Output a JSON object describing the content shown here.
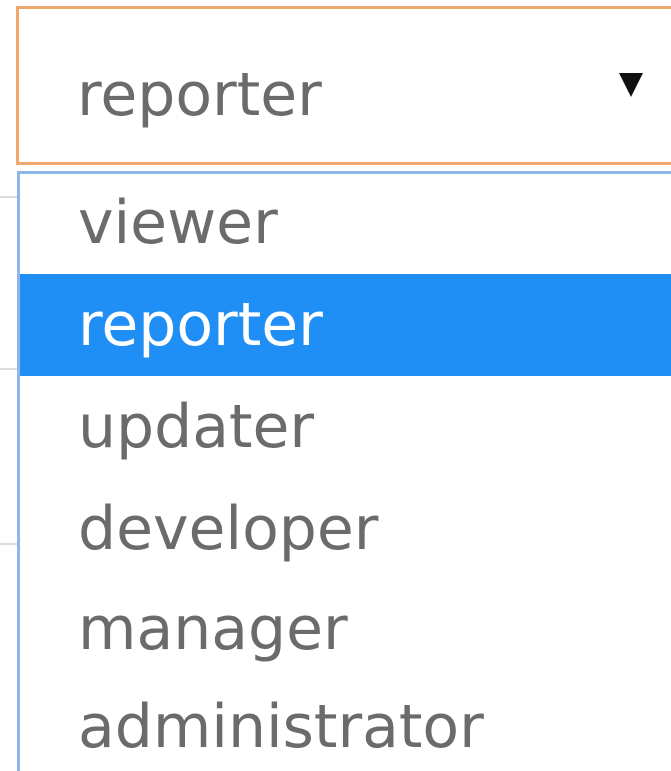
{
  "select": {
    "current_value": "reporter",
    "arrow_icon": "triangle-down-icon",
    "border_color": "#f0a96a"
  },
  "dropdown": {
    "border_color": "#8fb6e8",
    "selected_color": "#1f8ff5",
    "options": [
      {
        "label": "viewer",
        "selected": false
      },
      {
        "label": "reporter",
        "selected": true
      },
      {
        "label": "updater",
        "selected": false
      },
      {
        "label": "developer",
        "selected": false
      },
      {
        "label": "manager",
        "selected": false
      },
      {
        "label": "administrator",
        "selected": false
      }
    ]
  }
}
